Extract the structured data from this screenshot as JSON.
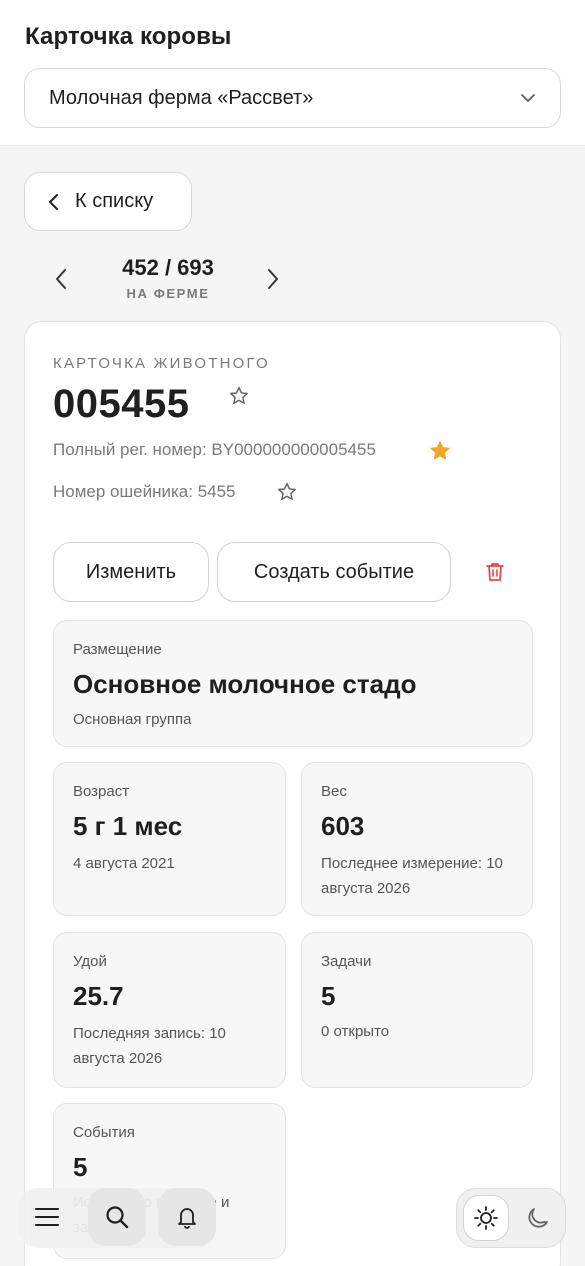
{
  "header": {
    "title": "Карточка коровы",
    "farm_select": {
      "value": "Молочная ферма «Рассвет»"
    }
  },
  "navigation": {
    "back_label": "К списку",
    "pager": {
      "count": "452 / 693",
      "subtitle": "НА ФЕРМЕ"
    }
  },
  "animal": {
    "kicker": "КАРТОЧКА ЖИВОТНОГО",
    "id": "005455",
    "reg_number": "Полный рег. номер: BY000000000005455",
    "collar_number": "Номер ошейника: 5455",
    "reg_number_starred": true,
    "id_starred": false,
    "collar_starred": false
  },
  "actions": {
    "edit_label": "Изменить",
    "create_event_label": "Создать событие"
  },
  "tiles": {
    "placement": {
      "label": "Размещение",
      "value": "Основное молочное стадо",
      "note": "Основная группа"
    },
    "age": {
      "label": "Возраст",
      "value": "5 г 1 мес",
      "note": "4 августа 2021"
    },
    "weight": {
      "label": "Вес",
      "value": "603",
      "note": "Последнее измерение: 10 августа 2026"
    },
    "milk": {
      "label": "Удой",
      "value": "25.7",
      "note": "Последняя запись: 10 августа 2026"
    },
    "tasks": {
      "label": "Задачи",
      "value": "5",
      "note": "0 открыто"
    },
    "events": {
      "label": "События",
      "value": "5",
      "note": "История по карточке и задачам"
    }
  },
  "colors": {
    "star_active": "#f5a623",
    "delete": "#e5484d",
    "background": "#f5f5f5"
  },
  "icons": [
    "chevron-down-icon",
    "chevron-left-icon",
    "chevron-right-icon",
    "star-icon",
    "trash-icon",
    "menu-icon",
    "search-icon",
    "bell-icon",
    "sun-icon",
    "moon-icon"
  ]
}
